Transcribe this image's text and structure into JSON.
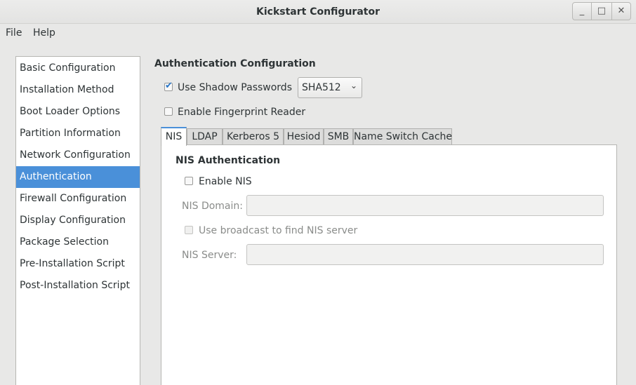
{
  "window": {
    "title": "Kickstart Configurator",
    "minimize_glyph": "_",
    "maximize_glyph": "□",
    "close_glyph": "✕"
  },
  "menubar": {
    "file": "File",
    "help": "Help"
  },
  "sidebar": {
    "items": [
      "Basic Configuration",
      "Installation Method",
      "Boot Loader Options",
      "Partition Information",
      "Network Configuration",
      "Authentication",
      "Firewall Configuration",
      "Display Configuration",
      "Package Selection",
      "Pre-Installation Script",
      "Post-Installation Script"
    ],
    "selected": "Authentication"
  },
  "auth": {
    "title": "Authentication Configuration",
    "shadow_passwords": {
      "label": "Use Shadow Passwords",
      "checked": true
    },
    "hash_select": {
      "value": "SHA512",
      "arrow": "⌄"
    },
    "fingerprint": {
      "label": "Enable Fingerprint Reader",
      "checked": false
    }
  },
  "tabs": {
    "items": [
      "NIS",
      "LDAP",
      "Kerberos 5",
      "Hesiod",
      "SMB",
      "Name Switch Cache"
    ],
    "active": "NIS"
  },
  "nis": {
    "title": "NIS Authentication",
    "enable": {
      "label": "Enable NIS",
      "checked": false
    },
    "domain": {
      "label": "NIS Domain:",
      "value": ""
    },
    "broadcast": {
      "label": "Use broadcast to find NIS server",
      "checked": false
    },
    "server": {
      "label": "NIS Server:",
      "value": ""
    }
  },
  "colors": {
    "selection": "#4a90d9",
    "window_bg": "#e8e8e7",
    "disabled_text": "#8a8c8a"
  }
}
